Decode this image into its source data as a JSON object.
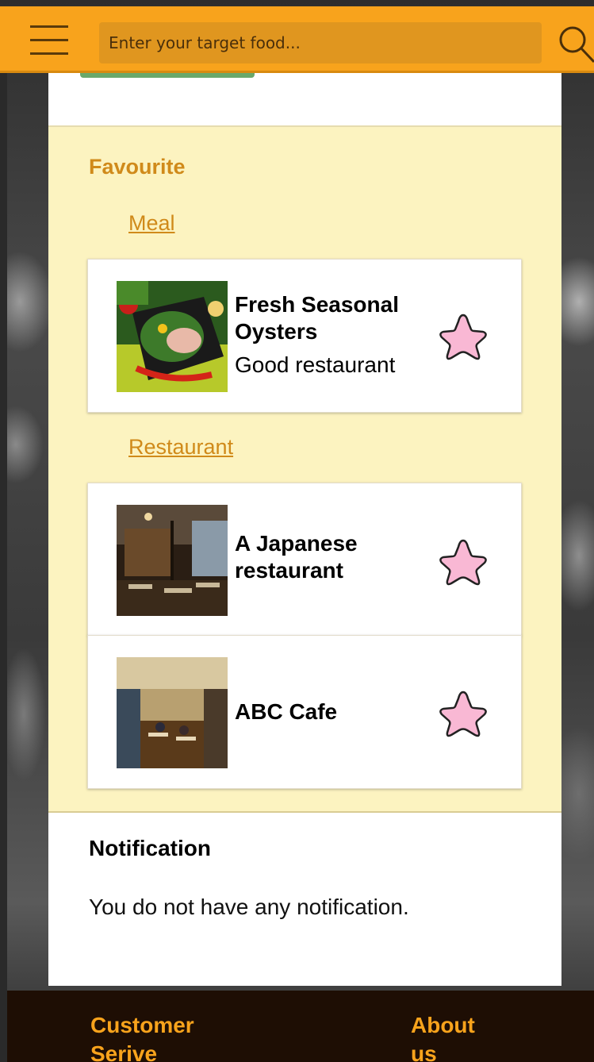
{
  "search": {
    "placeholder": "Enter your target food..."
  },
  "favourite": {
    "title": "Favourite",
    "meal_label": "Meal",
    "restaurant_label": "Restaurant",
    "meals": [
      {
        "title": "Fresh Seasonal Oysters",
        "subtitle": "Good restaurant"
      }
    ],
    "restaurants": [
      {
        "title": "A Japanese restaurant"
      },
      {
        "title": "ABC Cafe"
      }
    ]
  },
  "notification": {
    "title": "Notification",
    "message": "You do not have any notification."
  },
  "footer": {
    "customer_service": "Customer Serive",
    "about_us": "About us"
  },
  "colors": {
    "topbar": "#f8a31c",
    "favourite_bg": "#fcf3c0",
    "accent_text": "#d08a1a",
    "star_fill": "#f9b8d4",
    "footer_bg": "#1e0e04"
  }
}
